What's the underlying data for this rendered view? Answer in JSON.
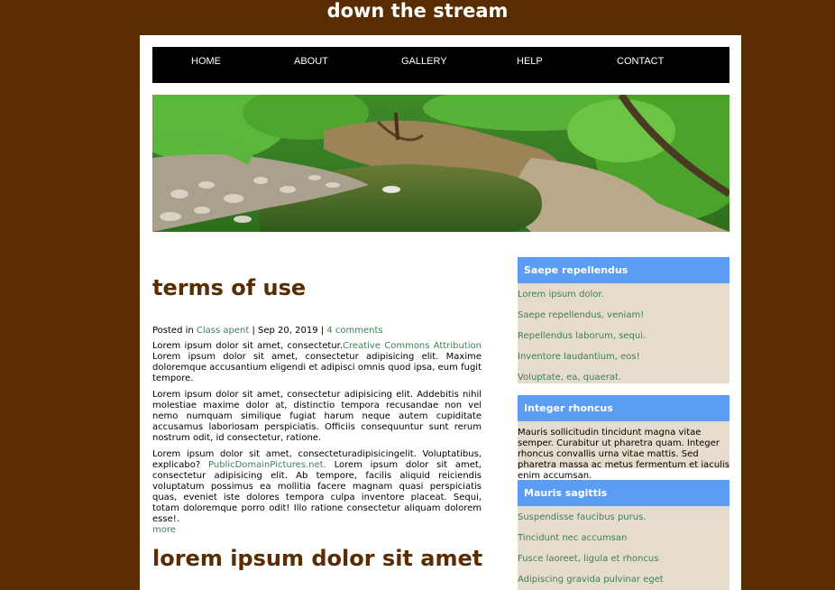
{
  "site": {
    "title": "down the stream"
  },
  "nav": {
    "items": [
      "HOME",
      "ABOUT",
      "GALLERY",
      "HELP",
      "CONTACT"
    ]
  },
  "posts": [
    {
      "title": "terms of use",
      "meta": {
        "prefix": "Posted in",
        "category": "Class apent",
        "sep1": "|",
        "date": "Sep 20, 2019",
        "sep2": "|",
        "comments": "4 comments"
      },
      "p1_text": "Lorem ipsum dolor sit amet, consectetur.",
      "p1_link": "Creative Commons Attribution",
      "p1_rest": "Lorem ipsum dolor sit amet, consectetur adipisicing elit. Maxime doloremque accusantium eligendi et adipisci omnis quod ipsa, eum fugit tempore.",
      "p2": "Lorem ipsum dolor sit amet, consectetur adipisicing elit. Addebitis nihil molestiae maxime dolor at, distinctio tempora recusandae non vel nemo numquam similique fugiat harum neque autem cupiditate accusamus laboriosam perspiciatis. Officiis consequuntur sunt rerum nostrum odit, id consectetur, ratione.",
      "p3_text": "Lorem ipsum dolor sit amet, consecteturadipisicingelit. Voluptatibus, explicabo?",
      "p3_link": "PublicDomainPictures.net.",
      "p3_rest": "Lorem ipsum dolor sit amet, consectetur adipisicing elit. Ab tempore, facilis aliquid reiciendis voluptatum possimus ea mollitia facere magnam quasi perspiciatis quas, eveniet iste dolores tempora culpa inventore placeat. Sequi, totam doloremque porro odit! Illo ratione consectetur aliquam dolorem esse!.",
      "more": "more"
    },
    {
      "title": "lorem ipsum dolor sit amet"
    }
  ],
  "sidebar": {
    "w1": {
      "title": "Saepe repellendus",
      "items": [
        "Lorem ipsum dolor.",
        "Saepe repellendus, veniam!",
        "Repellendus laborum, sequi.",
        "Inventore laudantium, eos!",
        "Voluptate, ea, quaerat."
      ]
    },
    "w2": {
      "title": "Integer rhoncus",
      "text": "Mauris sollicitudin tincidunt magna vitae semper. Curabitur ut pharetra quam. Integer rhoncus convallis urna vitae mattis. Sed pharetra massa ac metus fermentum et iaculis enim accumsan."
    },
    "w3": {
      "title": "Mauris sagittis",
      "items": [
        "Suspendisse faucibus purus.",
        "Tincidunt nec accumsan",
        "Fusce laoreet, ligula et rhoncus",
        "Adipiscing gravida pulvinar eget"
      ]
    }
  },
  "colors": {
    "background": "#5a2c02",
    "nav": "#000000",
    "widget_head": "#5b9cf4",
    "widget_body": "#e6dccd",
    "link": "#3f7e54"
  }
}
